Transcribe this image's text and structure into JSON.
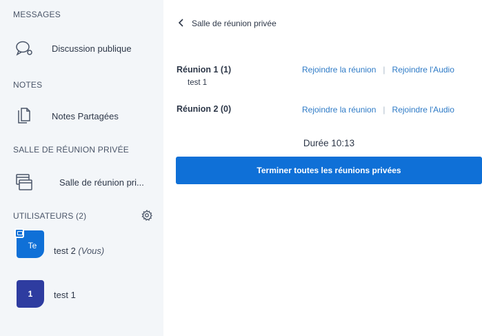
{
  "sidebar": {
    "messages_title": "MESSAGES",
    "public_chat": "Discussion publique",
    "notes_title": "NOTES",
    "shared_notes": "Notes Partagées",
    "breakout_title": "SALLE DE RÉUNION PRIVÉE",
    "breakout_item": "Salle de réunion pri...",
    "users_title": "UTILISATEURS (2)",
    "users": [
      {
        "initials": "Te",
        "name": "test 2",
        "suffix": "(Vous)",
        "color": "#0f70d7"
      },
      {
        "initials": "1",
        "name": "test 1",
        "suffix": "",
        "color": "#2e3ca0"
      }
    ]
  },
  "main": {
    "back_label": "Salle de réunion privée",
    "rooms": [
      {
        "title": "Réunion 1 (1)",
        "user": "test 1",
        "join": "Rejoindre la réunion",
        "join_audio": "Rejoindre l'Audio"
      },
      {
        "title": "Réunion 2 (0)",
        "user": "",
        "join": "Rejoindre la réunion",
        "join_audio": "Rejoindre l'Audio"
      }
    ],
    "separator": "|",
    "duration": "Durée 10:13",
    "end_all": "Terminer toutes les réunions privées"
  },
  "colors": {
    "accent": "#0f70d7",
    "link": "#2d7ac6",
    "sidebar_bg": "#f3f6f9"
  }
}
